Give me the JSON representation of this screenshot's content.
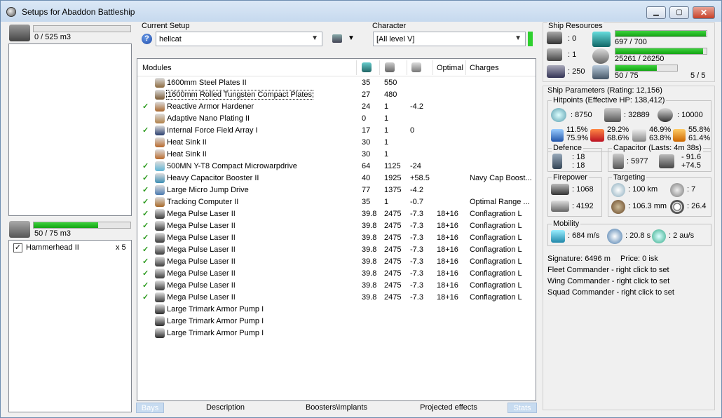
{
  "window": {
    "title": "Setups for Abaddon Battleship",
    "minimize": "▁",
    "maximize": "▢",
    "close": "✕"
  },
  "cargo": {
    "value": "0 / 525 m3",
    "fill": 0.0
  },
  "drones": {
    "bay_value": "50 / 75 m3",
    "fill": 0.67,
    "items": [
      {
        "name": "Hammerhead II",
        "count": "x 5",
        "checked": true
      }
    ]
  },
  "setup": {
    "label": "Current Setup",
    "value": "hellcat",
    "help": "?",
    "character_label": "Character",
    "character_value": "[All level V]"
  },
  "modules": {
    "headers": {
      "name": "Modules",
      "optimal": "Optimal",
      "charges": "Charges"
    },
    "rows": [
      {
        "active": false,
        "name": "1600mm Steel Plates II",
        "cpu": "35",
        "pg": "550",
        "cap": "",
        "optimal": "",
        "charges": "",
        "icon": "#8c6a3e"
      },
      {
        "active": false,
        "name": "1600mm Rolled Tungsten Compact Plates",
        "cpu": "27",
        "pg": "480",
        "cap": "",
        "optimal": "",
        "charges": "",
        "icon": "#7a5a33",
        "selected": true
      },
      {
        "active": true,
        "name": "Reactive Armor Hardener",
        "cpu": "24",
        "pg": "1",
        "cap": "-4.2",
        "optimal": "",
        "charges": "",
        "icon": "#a8662c"
      },
      {
        "active": false,
        "name": "Adaptive Nano Plating II",
        "cpu": "0",
        "pg": "1",
        "cap": "",
        "optimal": "",
        "charges": "",
        "icon": "#b08048"
      },
      {
        "active": true,
        "name": "Internal Force Field Array I",
        "cpu": "17",
        "pg": "1",
        "cap": "0",
        "optimal": "",
        "charges": "",
        "icon": "#2a3e6e"
      },
      {
        "active": false,
        "name": "Heat Sink II",
        "cpu": "30",
        "pg": "1",
        "cap": "",
        "optimal": "",
        "charges": "",
        "icon": "#b86a2c"
      },
      {
        "active": false,
        "name": "Heat Sink II",
        "cpu": "30",
        "pg": "1",
        "cap": "",
        "optimal": "",
        "charges": "",
        "icon": "#b86a2c"
      },
      {
        "active": true,
        "name": "500MN Y-T8 Compact Microwarpdrive",
        "cpu": "64",
        "pg": "1125",
        "cap": "-24",
        "optimal": "",
        "charges": "",
        "icon": "#5fb4d4"
      },
      {
        "active": true,
        "name": "Heavy Capacitor Booster II",
        "cpu": "40",
        "pg": "1925",
        "cap": "+58.5",
        "optimal": "",
        "charges": "Navy Cap Boost...",
        "icon": "#3e8fb4"
      },
      {
        "active": true,
        "name": "Large Micro Jump Drive",
        "cpu": "77",
        "pg": "1375",
        "cap": "-4.2",
        "optimal": "",
        "charges": "",
        "icon": "#4a7ab0"
      },
      {
        "active": true,
        "name": "Tracking Computer II",
        "cpu": "35",
        "pg": "1",
        "cap": "-0.7",
        "optimal": "",
        "charges": "Optimal Range ...",
        "icon": "#a86a2a"
      },
      {
        "active": true,
        "name": "Mega Pulse Laser II",
        "cpu": "39.8",
        "pg": "2475",
        "cap": "-7.3",
        "optimal": "18+16",
        "charges": "Conflagration L",
        "icon": "#3a3a3a"
      },
      {
        "active": true,
        "name": "Mega Pulse Laser II",
        "cpu": "39.8",
        "pg": "2475",
        "cap": "-7.3",
        "optimal": "18+16",
        "charges": "Conflagration L",
        "icon": "#3a3a3a"
      },
      {
        "active": true,
        "name": "Mega Pulse Laser II",
        "cpu": "39.8",
        "pg": "2475",
        "cap": "-7.3",
        "optimal": "18+16",
        "charges": "Conflagration L",
        "icon": "#3a3a3a"
      },
      {
        "active": true,
        "name": "Mega Pulse Laser II",
        "cpu": "39.8",
        "pg": "2475",
        "cap": "-7.3",
        "optimal": "18+16",
        "charges": "Conflagration L",
        "icon": "#3a3a3a"
      },
      {
        "active": true,
        "name": "Mega Pulse Laser II",
        "cpu": "39.8",
        "pg": "2475",
        "cap": "-7.3",
        "optimal": "18+16",
        "charges": "Conflagration L",
        "icon": "#3a3a3a"
      },
      {
        "active": true,
        "name": "Mega Pulse Laser II",
        "cpu": "39.8",
        "pg": "2475",
        "cap": "-7.3",
        "optimal": "18+16",
        "charges": "Conflagration L",
        "icon": "#3a3a3a"
      },
      {
        "active": true,
        "name": "Mega Pulse Laser II",
        "cpu": "39.8",
        "pg": "2475",
        "cap": "-7.3",
        "optimal": "18+16",
        "charges": "Conflagration L",
        "icon": "#3a3a3a"
      },
      {
        "active": true,
        "name": "Mega Pulse Laser II",
        "cpu": "39.8",
        "pg": "2475",
        "cap": "-7.3",
        "optimal": "18+16",
        "charges": "Conflagration L",
        "icon": "#3a3a3a"
      },
      {
        "active": false,
        "name": "Large Trimark Armor Pump I",
        "cpu": "",
        "pg": "",
        "cap": "",
        "optimal": "",
        "charges": "",
        "icon": "#2a2a2a"
      },
      {
        "active": false,
        "name": "Large Trimark Armor Pump I",
        "cpu": "",
        "pg": "",
        "cap": "",
        "optimal": "",
        "charges": "",
        "icon": "#2a2a2a"
      },
      {
        "active": false,
        "name": "Large Trimark Armor Pump I",
        "cpu": "",
        "pg": "",
        "cap": "",
        "optimal": "",
        "charges": "",
        "icon": "#2a2a2a"
      }
    ]
  },
  "tabs": [
    "Bays",
    "Description",
    "Boosters\\Implants",
    "Projected effects",
    "Stats"
  ],
  "resources": {
    "title": "Ship Resources",
    "turret_slots": ": 0",
    "launcher_slots": ": 1",
    "drone_bw": ": 250",
    "cpu": {
      "value": "697 / 700",
      "fill": 0.996
    },
    "pg": {
      "value": "25261 / 26250",
      "fill": 0.962
    },
    "calib": {
      "value": "50 / 75",
      "fill": 0.667,
      "extra": "5 / 5"
    }
  },
  "params": {
    "title": "Ship Parameters (Rating: 12,156)",
    "hitpoints": {
      "title": "Hitpoints (Effective HP: 138,412)",
      "shield": ": 8750",
      "armor": ": 32889",
      "structure": ": 10000",
      "em": [
        "11.5%",
        "75.9%"
      ],
      "thermal": [
        "29.2%",
        "68.6%"
      ],
      "kinetic": [
        "46.9%",
        "63.8%"
      ],
      "explosive": [
        "55.8%",
        "61.4%"
      ]
    },
    "defence": {
      "title": "Defence",
      "v1": ": 18",
      "v2": ": 18"
    },
    "capacitor": {
      "title": "Capacitor (Lasts: 4m 38s)",
      "v1": ": 5977",
      "v2": "- 91.6",
      "v3": "+74.5"
    },
    "firepower": {
      "title": "Firepower",
      "v1": ": 1068",
      "v2": ": 4192"
    },
    "targeting": {
      "title": "Targeting",
      "range": ": 100 km",
      "targets": ": 7",
      "res": ": 106.3 mm",
      "sig": ": 26.4"
    },
    "mobility": {
      "title": "Mobility",
      "speed": ": 684 m/s",
      "align": ": 20.8 s",
      "warp": ": 2 au/s"
    },
    "signature": "Signature: 6496 m",
    "price": "Price: 0 isk",
    "fleet": "Fleet Commander - right click to set",
    "wing": "Wing Commander - right click to set",
    "squad": "Squad Commander - right click to set"
  }
}
